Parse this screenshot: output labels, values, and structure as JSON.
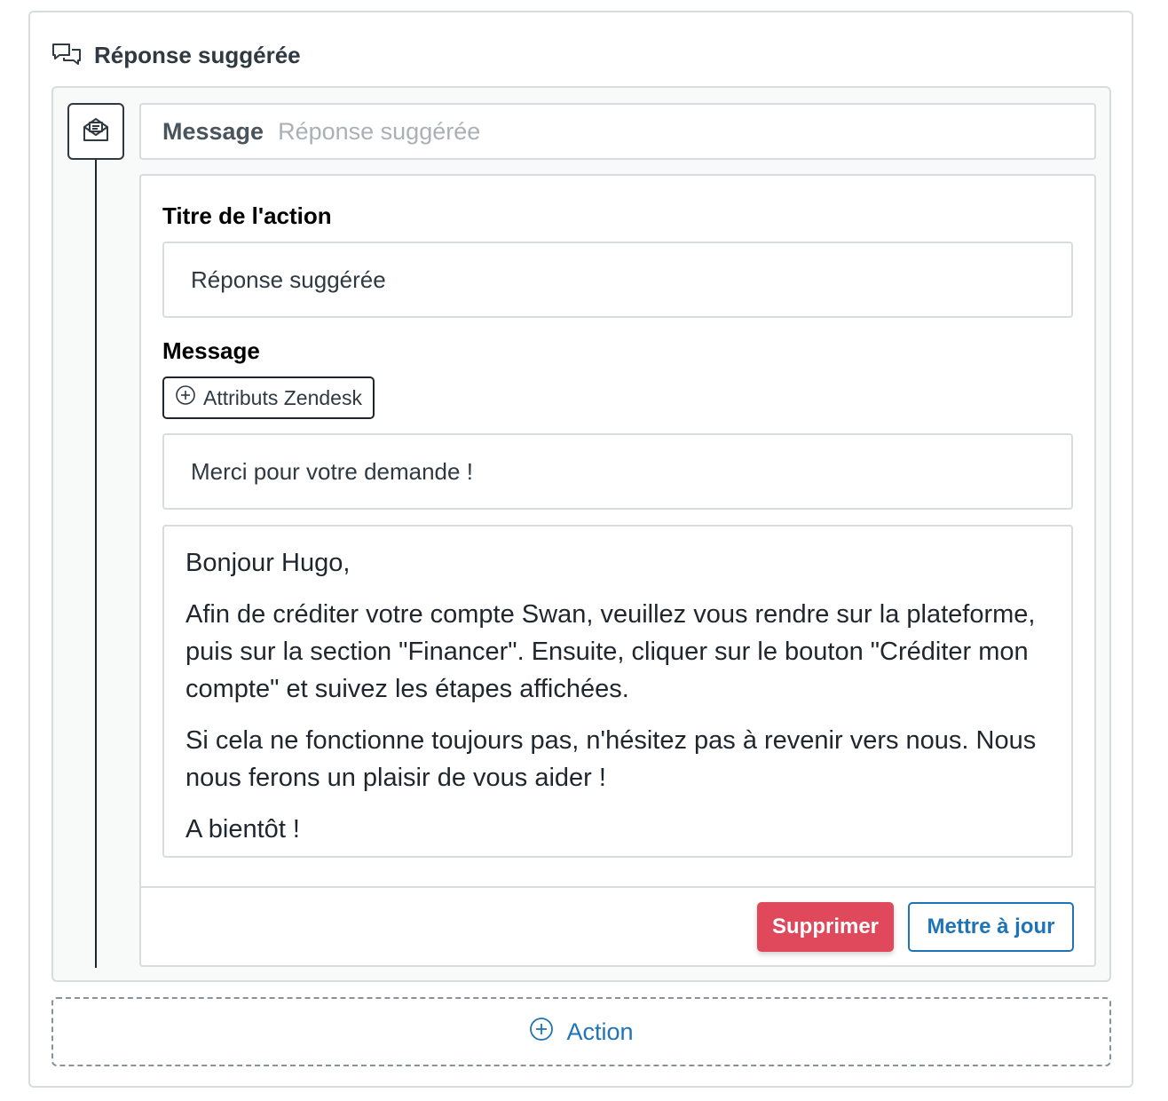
{
  "card": {
    "title": "Réponse suggérée",
    "icon": "chat-bubbles-icon"
  },
  "step": {
    "icon": "envelope-open-icon",
    "type_label": "Message",
    "name": "Réponse suggérée",
    "action_title_label": "Titre de l'action",
    "action_title_value": "Réponse suggérée",
    "message_label": "Message",
    "attributes_button": "Attributs Zendesk",
    "subject_value": "Merci pour votre demande !",
    "body": {
      "p1": "Bonjour Hugo,",
      "p2": "Afin de créditer votre compte Swan, veuillez vous rendre sur la plateforme, puis sur la section \"Financer\". Ensuite, cliquer sur le bouton \"Créditer mon compte\" et suivez les étapes affichées.",
      "p3": "Si cela ne fonctionne toujours pas, n'hésitez pas à revenir vers nous. Nous nous ferons un plaisir de vous aider !",
      "p4": "A bientôt !"
    },
    "delete_label": "Supprimer",
    "update_label": "Mettre à jour"
  },
  "add_action": {
    "label": "Action",
    "icon": "plus-circle-icon"
  },
  "colors": {
    "accent": "#1f73b7",
    "danger": "#e0485c",
    "border": "#d8dcde",
    "panel_bg": "#f8f9f9"
  }
}
